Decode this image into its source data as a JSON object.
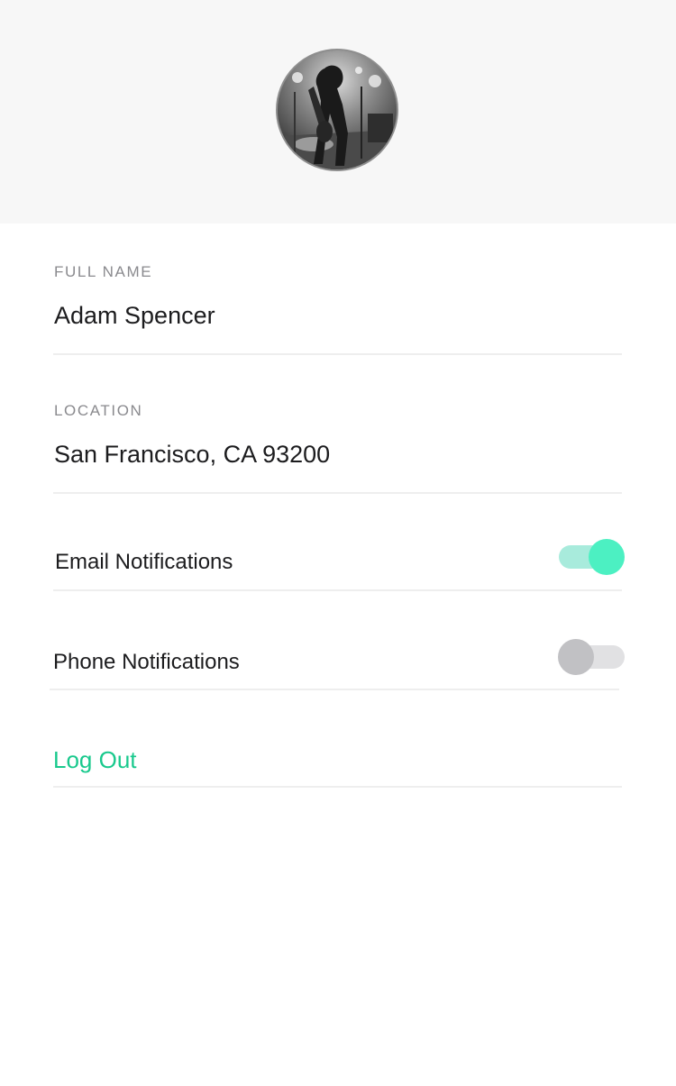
{
  "profile": {
    "avatar_icon": "avatar-photo"
  },
  "fields": {
    "full_name": {
      "label": "FULL NAME",
      "value": "Adam Spencer"
    },
    "location": {
      "label": "LOCATION",
      "value": "San Francisco, CA 93200"
    }
  },
  "toggles": {
    "email": {
      "label": "Email Notifications",
      "enabled": true
    },
    "phone": {
      "label": "Phone Notifications",
      "enabled": false
    }
  },
  "actions": {
    "logout_label": "Log Out"
  },
  "colors": {
    "accent": "#19c98d",
    "toggle_on_knob": "#4cf0c2",
    "toggle_on_track": "#a8ebdc",
    "toggle_off_knob": "#c1c1c4",
    "toggle_off_track": "#e1e1e3",
    "header_bg": "#f7f7f7"
  }
}
